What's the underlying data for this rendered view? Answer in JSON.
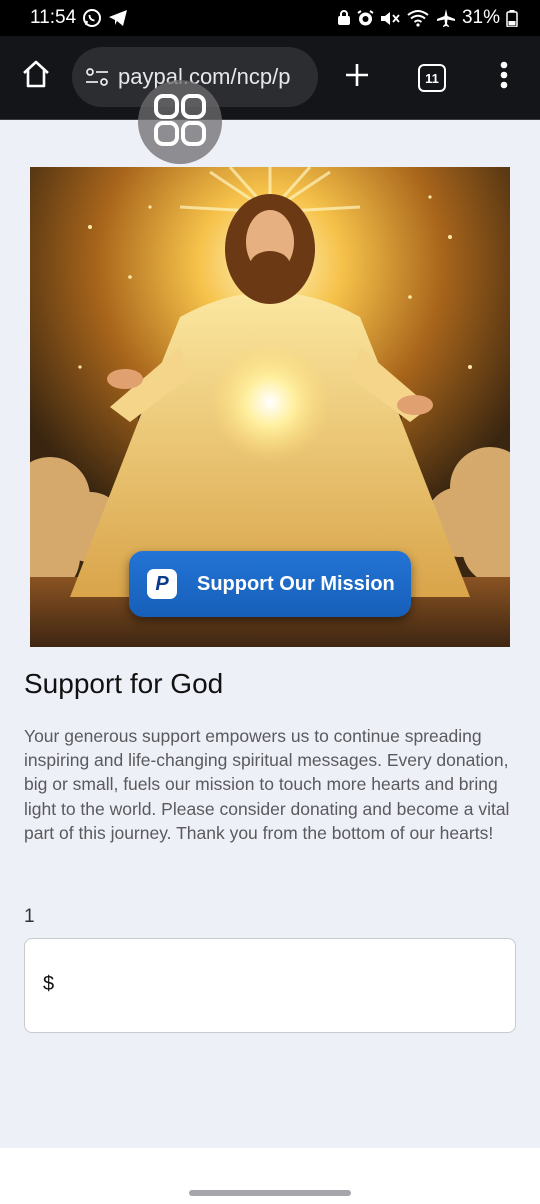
{
  "status_bar": {
    "time": "11:54",
    "battery": "31%",
    "icons": [
      "whatsapp-icon",
      "telegram-icon",
      "lock-icon",
      "alarm-icon",
      "mute-icon",
      "wifi-icon",
      "airplane-icon",
      "battery-icon"
    ]
  },
  "browser": {
    "url": "paypal.com/ncp/p",
    "tab_count": "11",
    "icons": [
      "home-icon",
      "site-settings-icon",
      "plus-icon",
      "tabs-icon",
      "more-vert-icon"
    ]
  },
  "page": {
    "support_button_label": "Support Our Mission",
    "title": "Support for God",
    "description": "Your generous support empowers us to continue spreading inspiring and life-changing spiritual messages. Every donation, big or small, fuels our mission to touch more hearts and bring light to the world. Please consider donating and become a vital part of this journey. Thank you from the bottom of our hearts!",
    "quantity": "1",
    "currency_symbol": "$",
    "amount_value": ""
  },
  "colors": {
    "page_background": "#eef0f8",
    "toolbar_background": "#141518",
    "button_blue": "#1d6ac9"
  }
}
